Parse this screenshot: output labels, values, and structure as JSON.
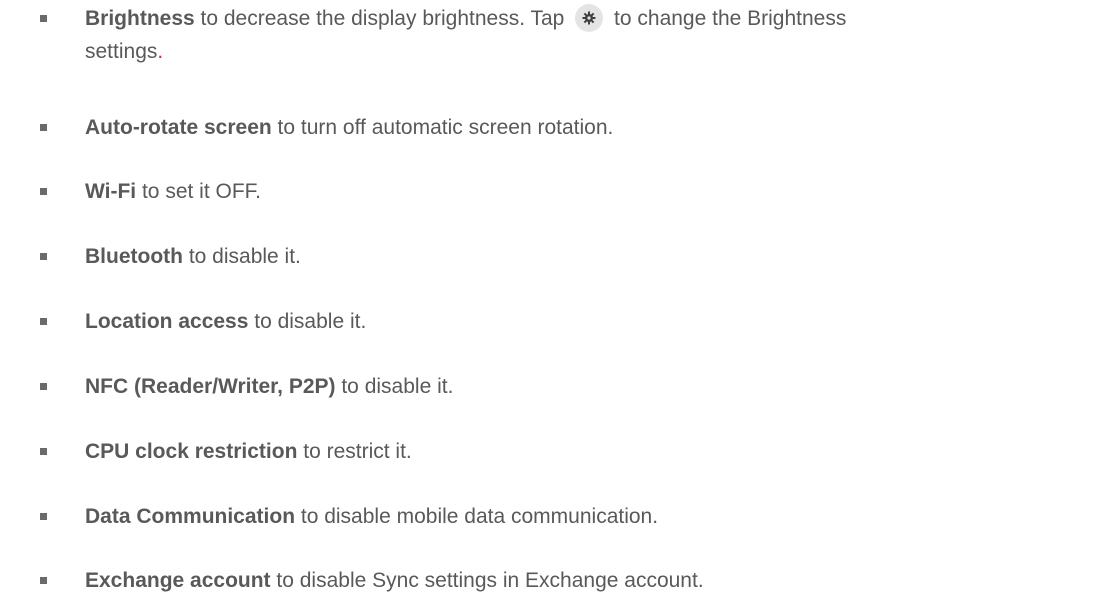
{
  "items": [
    {
      "bold": "Brightness",
      "text_before_icon": " to decrease the display brightness. Tap ",
      "icon": "gear-icon",
      "text_after_icon": " to change the Brightness",
      "text_line2": "settings",
      "trailing": "."
    },
    {
      "bold": "Auto-rotate screen",
      "text": " to turn off automatic screen rotation."
    },
    {
      "bold": "Wi-Fi",
      "text": " to set it OFF."
    },
    {
      "bold": "Bluetooth",
      "text": " to disable it."
    },
    {
      "bold": "Location access",
      "text": " to disable it."
    },
    {
      "bold": "NFC (Reader/Writer, P2P)",
      "text": " to disable it."
    },
    {
      "bold": "CPU clock restriction",
      "text": " to restrict it."
    },
    {
      "bold": "Data Communication",
      "text": " to disable mobile data communication."
    },
    {
      "bold": "Exchange account",
      "text": " to disable Sync settings in Exchange account."
    }
  ],
  "colors": {
    "text": "#595959",
    "bullet": "#6a6a6a",
    "icon_bg": "#e4e4e4",
    "accent_dot": "#d6204b"
  }
}
